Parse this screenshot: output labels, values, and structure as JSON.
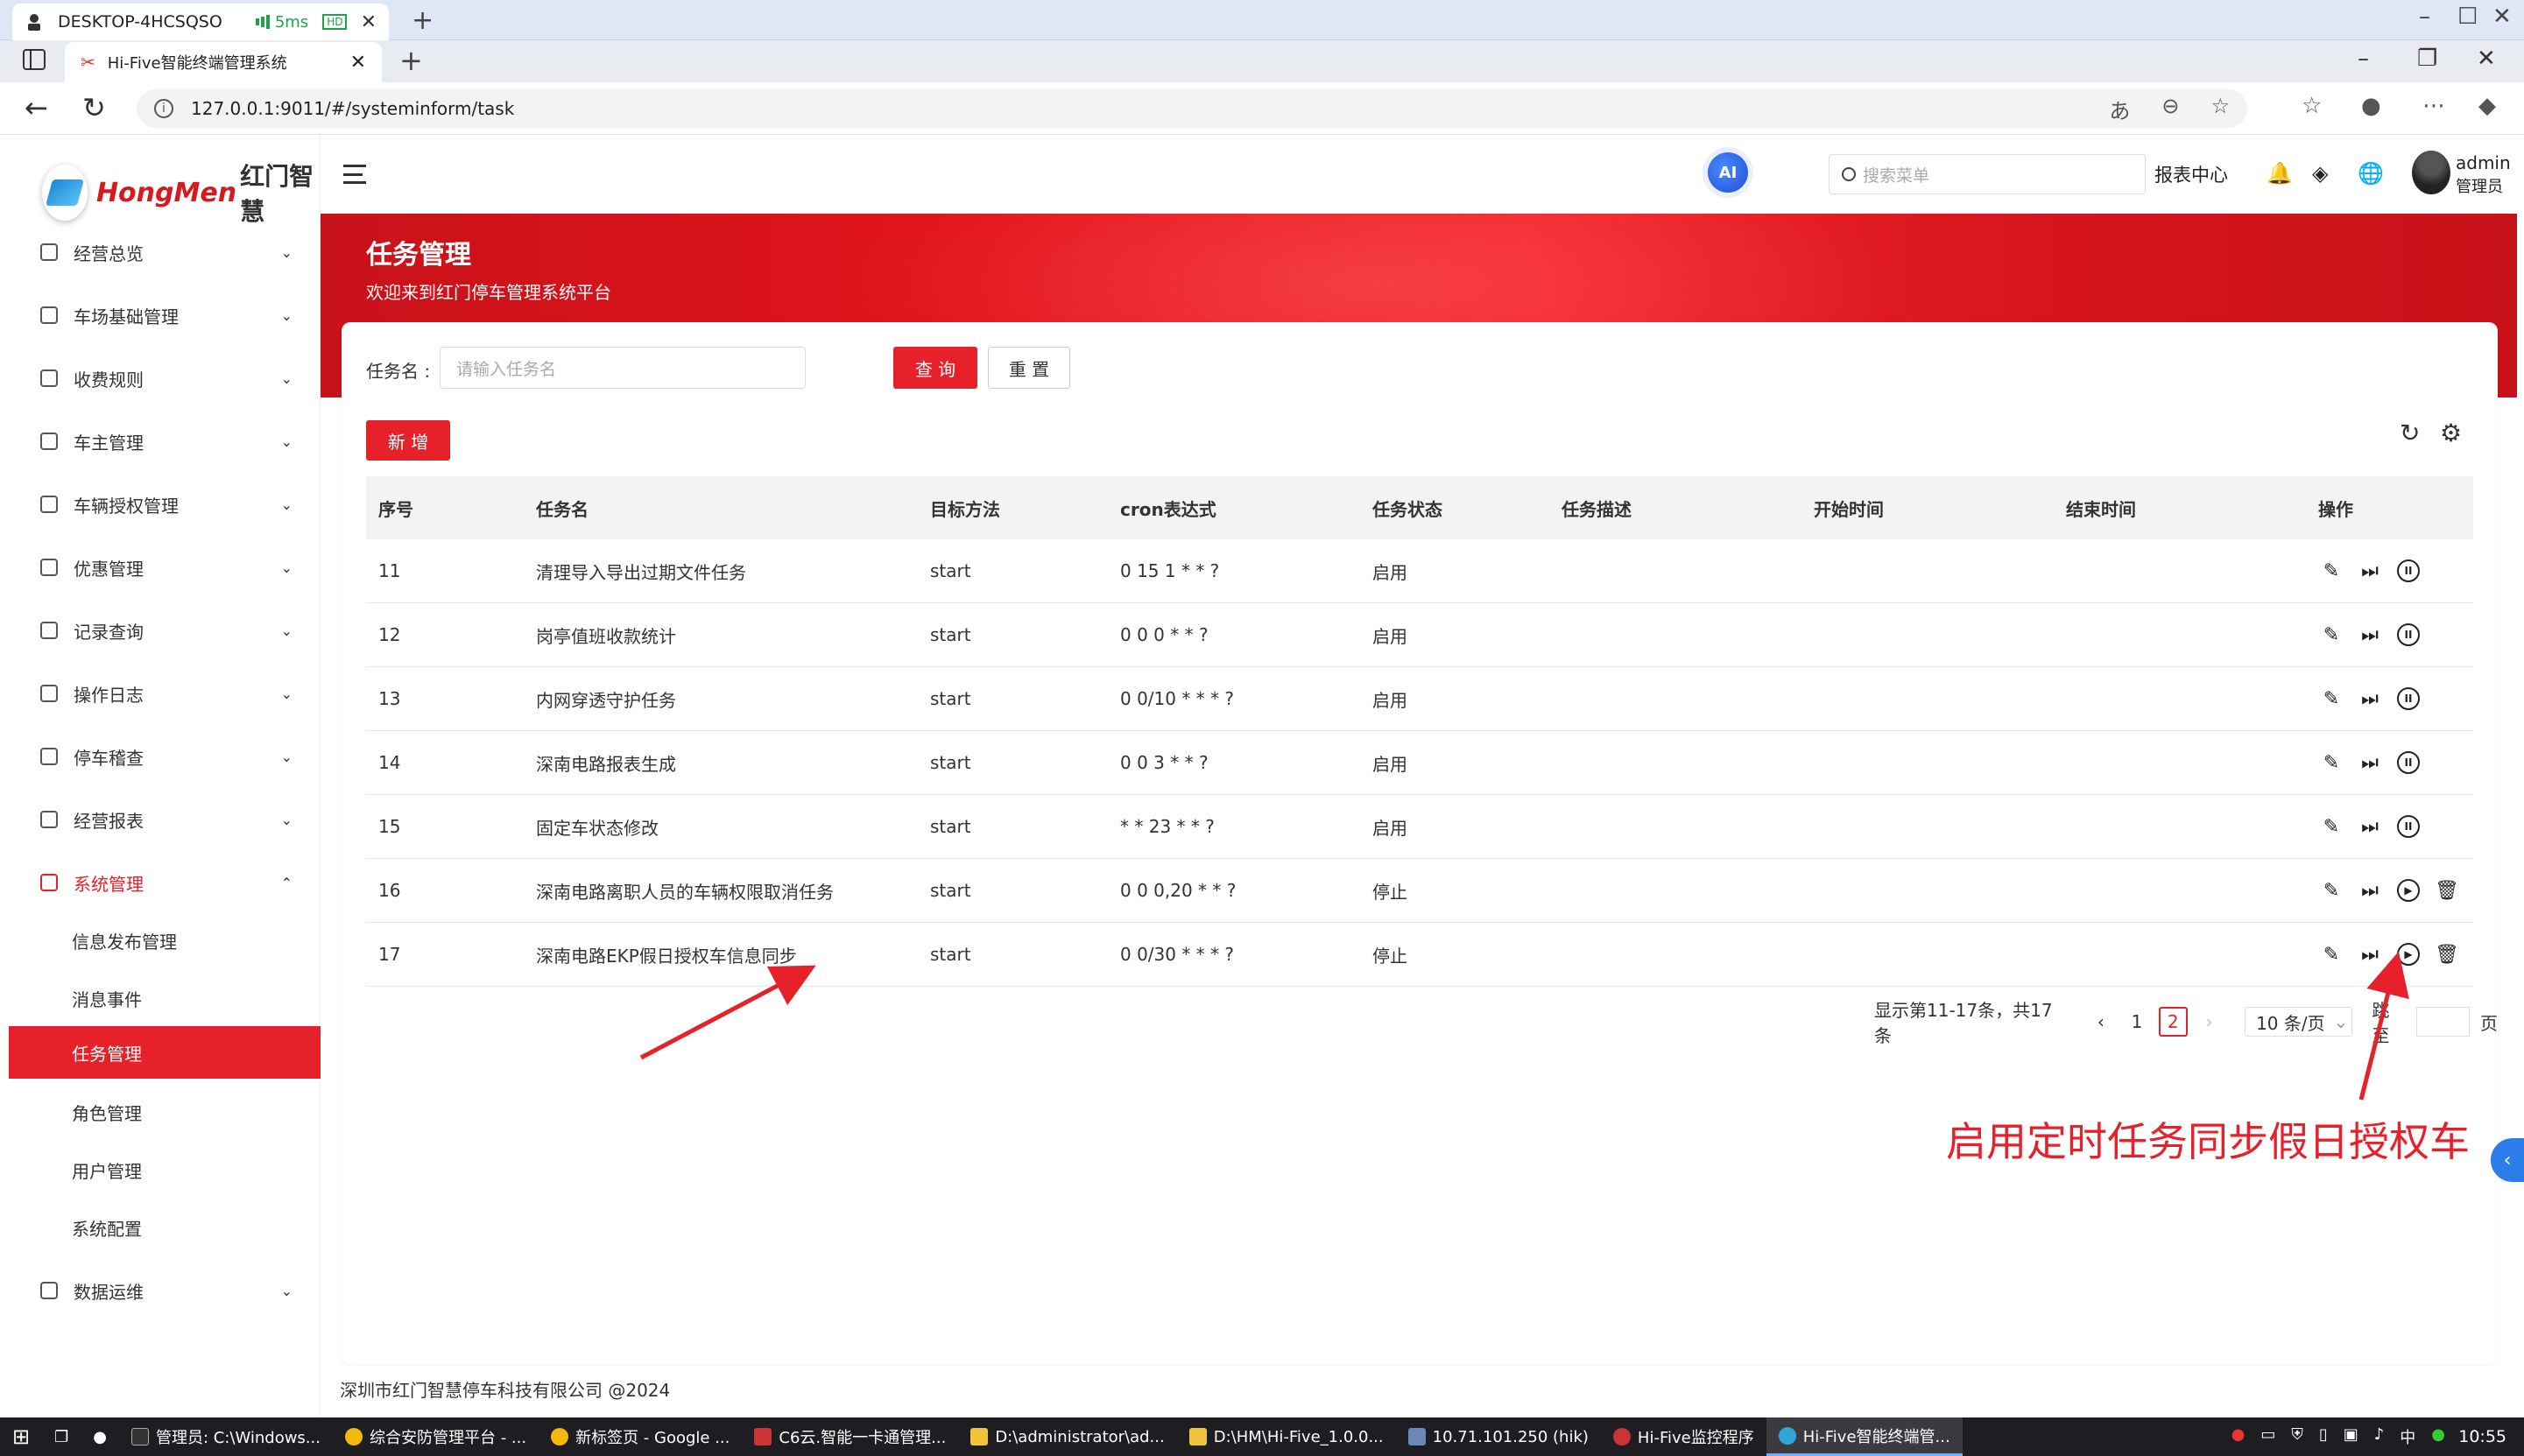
{
  "remote": {
    "machine": "DESKTOP-4HCSQSO",
    "latency": "5ms",
    "quality": "HD"
  },
  "browser": {
    "tab_title": "Hi-Five智能终端管理系统",
    "url": "127.0.0.1:9011/#/systeminform/task"
  },
  "app": {
    "brand_logo_text": "HongMen",
    "brand_cn": "红门智慧",
    "ai_badge": "AI",
    "search_placeholder": "搜索菜单",
    "report_center": "报表中心",
    "user_name": "admin",
    "user_role": "管理员"
  },
  "sidebar": {
    "menu": [
      {
        "label": "经营总览"
      },
      {
        "label": "车场基础管理"
      },
      {
        "label": "收费规则"
      },
      {
        "label": "车主管理"
      },
      {
        "label": "车辆授权管理"
      },
      {
        "label": "优惠管理"
      },
      {
        "label": "记录查询"
      },
      {
        "label": "操作日志"
      },
      {
        "label": "停车稽查"
      },
      {
        "label": "经营报表"
      },
      {
        "label": "系统管理"
      }
    ],
    "submenu": [
      {
        "label": "信息发布管理"
      },
      {
        "label": "消息事件"
      },
      {
        "label": "任务管理"
      },
      {
        "label": "角色管理"
      },
      {
        "label": "用户管理"
      },
      {
        "label": "系统配置"
      }
    ],
    "last": {
      "label": "数据运维"
    }
  },
  "hero": {
    "title": "任务管理",
    "subtitle": "欢迎来到红门停车管理系统平台"
  },
  "filter": {
    "label": "任务名 :",
    "placeholder": "请输入任务名",
    "query": "查 询",
    "reset": "重 置",
    "add": "新 增"
  },
  "table": {
    "headers": [
      "序号",
      "任务名",
      "目标方法",
      "cron表达式",
      "任务状态",
      "任务描述",
      "开始时间",
      "结束时间",
      "操作"
    ],
    "rows": [
      {
        "id": "11",
        "name": "清理导入导出过期文件任务",
        "method": "start",
        "cron": "0 15 1 * * ?",
        "status": "启用"
      },
      {
        "id": "12",
        "name": "岗亭值班收款统计",
        "method": "start",
        "cron": "0 0 0 * * ?",
        "status": "启用"
      },
      {
        "id": "13",
        "name": "内网穿透守护任务",
        "method": "start",
        "cron": "0 0/10 * * * ?",
        "status": "启用"
      },
      {
        "id": "14",
        "name": "深南电路报表生成",
        "method": "start",
        "cron": "0 0 3 * * ?",
        "status": "启用"
      },
      {
        "id": "15",
        "name": "固定车状态修改",
        "method": "start",
        "cron": "* * 23 * * ?",
        "status": "启用"
      },
      {
        "id": "16",
        "name": "深南电路离职人员的车辆权限取消任务",
        "method": "start",
        "cron": "0 0 0,20 * * ?",
        "status": "停止"
      },
      {
        "id": "17",
        "name": "深南电路EKP假日授权车信息同步",
        "method": "start",
        "cron": "0 0/30 * * * ?",
        "status": "停止"
      }
    ]
  },
  "pager": {
    "summary": "显示第11-17条，共17条",
    "page1": "1",
    "page2": "2",
    "size": "10 条/页",
    "jump": "跳至",
    "page_unit": "页"
  },
  "annotation": "启用定时任务同步假日授权车",
  "footer": "深圳市红门智慧停车科技有限公司 @2024",
  "taskbar": {
    "items": [
      {
        "label": "管理员: C:\\Windows..."
      },
      {
        "label": "综合安防管理平台 - ..."
      },
      {
        "label": "新标签页 - Google ..."
      },
      {
        "label": "C6云.智能一卡通管理..."
      },
      {
        "label": "D:\\administrator\\ad..."
      },
      {
        "label": "D:\\HM\\Hi-Five_1.0.0..."
      },
      {
        "label": "10.71.101.250 (hik)"
      },
      {
        "label": "Hi-Five监控程序"
      },
      {
        "label": "Hi-Five智能终端管..."
      }
    ],
    "ime": "中",
    "time": "10:55"
  },
  "colors": {
    "accent": "#e6212a",
    "hero_red": "#e3141b",
    "taskbar": "#1e1e22"
  }
}
